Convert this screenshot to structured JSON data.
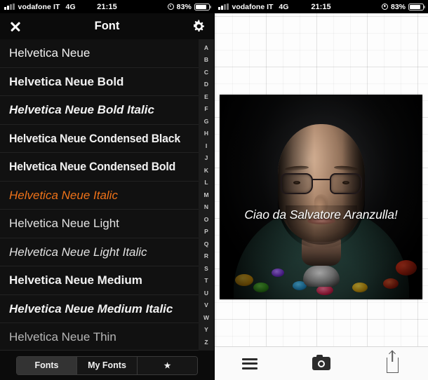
{
  "status_bar": {
    "carrier": "vodafone IT",
    "network": "4G",
    "time": "21:15",
    "battery_percent": "83%",
    "battery_level": 83,
    "signal_icon": "signal-bars-icon",
    "lock_icon": "rotation-lock-icon",
    "battery_icon": "battery-icon"
  },
  "left_pane": {
    "nav": {
      "close_icon": "close-x-icon",
      "title": "Font",
      "settings_icon": "gear-icon"
    },
    "fonts": [
      {
        "name": "Helvetica Neue",
        "style": "st-regular",
        "selected": false
      },
      {
        "name": "Helvetica Neue Bold",
        "style": "st-bold",
        "selected": false
      },
      {
        "name": "Helvetica Neue Bold Italic",
        "style": "st-bolditalic",
        "selected": false
      },
      {
        "name": "Helvetica Neue Condensed Black",
        "style": "st-cond-black",
        "selected": false
      },
      {
        "name": "Helvetica Neue Condensed Bold",
        "style": "st-cond-bold",
        "selected": false
      },
      {
        "name": "Helvetica Neue Italic",
        "style": "st-italic",
        "selected": true
      },
      {
        "name": "Helvetica Neue Light",
        "style": "st-light",
        "selected": false
      },
      {
        "name": "Helvetica Neue Light Italic",
        "style": "st-lightitalic",
        "selected": false
      },
      {
        "name": "Helvetica Neue Medium",
        "style": "st-medium",
        "selected": false
      },
      {
        "name": "Helvetica Neue Medium Italic",
        "style": "st-mediumitalic",
        "selected": false
      },
      {
        "name": "Helvetica Neue Thin",
        "style": "st-thin",
        "selected": false
      }
    ],
    "alphabet_index": [
      "A",
      "B",
      "C",
      "D",
      "E",
      "F",
      "G",
      "H",
      "I",
      "J",
      "K",
      "L",
      "M",
      "N",
      "O",
      "P",
      "Q",
      "R",
      "S",
      "T",
      "U",
      "V",
      "W",
      "Y",
      "Z"
    ],
    "segmented_control": [
      {
        "label": "Fonts",
        "active": true,
        "icon": null
      },
      {
        "label": "My Fonts",
        "active": false,
        "icon": null
      },
      {
        "label": "★",
        "active": false,
        "icon": "star-icon"
      }
    ]
  },
  "right_pane": {
    "canvas": {
      "background": "transparency-grid",
      "image_caption": "Ciao da Salvatore Aranzulla!"
    },
    "toolbar": [
      {
        "label": "",
        "icon": "hamburger-menu-icon"
      },
      {
        "label": "",
        "icon": "camera-icon"
      },
      {
        "label": "",
        "icon": "share-icon"
      }
    ]
  },
  "colors": {
    "selected_font": "#ee7219",
    "left_background": "#111111",
    "navbar_background": "#0b0b0b",
    "canvas_background": "#fdfdfd",
    "toolbar_background": "#fafafa"
  }
}
